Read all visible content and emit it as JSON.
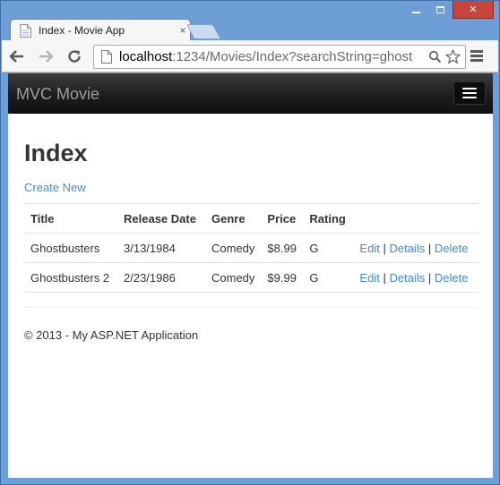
{
  "browser": {
    "tab_title": "Index - Movie App",
    "tab_close_glyph": "×",
    "url_host": "localhost",
    "url_rest": ":1234/Movies/Index?searchString=ghost",
    "icons": [
      "back-icon",
      "forward-icon",
      "reload-icon",
      "search-icon",
      "star-icon",
      "menu-icon"
    ],
    "glyphs": {
      "back": "🡐",
      "forward": "🡒",
      "reload": "↻",
      "search": "⚲",
      "star": "☆",
      "close": "✕"
    }
  },
  "site": {
    "brand": "MVC Movie",
    "page_title": "Index",
    "create_link": "Create New",
    "footer": "© 2013 - My ASP.NET Application"
  },
  "table": {
    "columns": [
      "Title",
      "Release Date",
      "Genre",
      "Price",
      "Rating",
      ""
    ],
    "rows": [
      {
        "title": "Ghostbusters",
        "release_date": "3/13/1984",
        "genre": "Comedy",
        "price": "$8.99",
        "rating": "G"
      },
      {
        "title": "Ghostbusters 2",
        "release_date": "2/23/1986",
        "genre": "Comedy",
        "price": "$9.99",
        "rating": "G"
      }
    ],
    "actions": {
      "edit": "Edit",
      "details": "Details",
      "delete": "Delete",
      "separator": "|"
    }
  },
  "colors": {
    "link": "#428bca",
    "navbar": "#222222",
    "brand_text": "#9d9d9d",
    "window_frame": "#6d9fd6",
    "close_button": "#c7453a"
  }
}
